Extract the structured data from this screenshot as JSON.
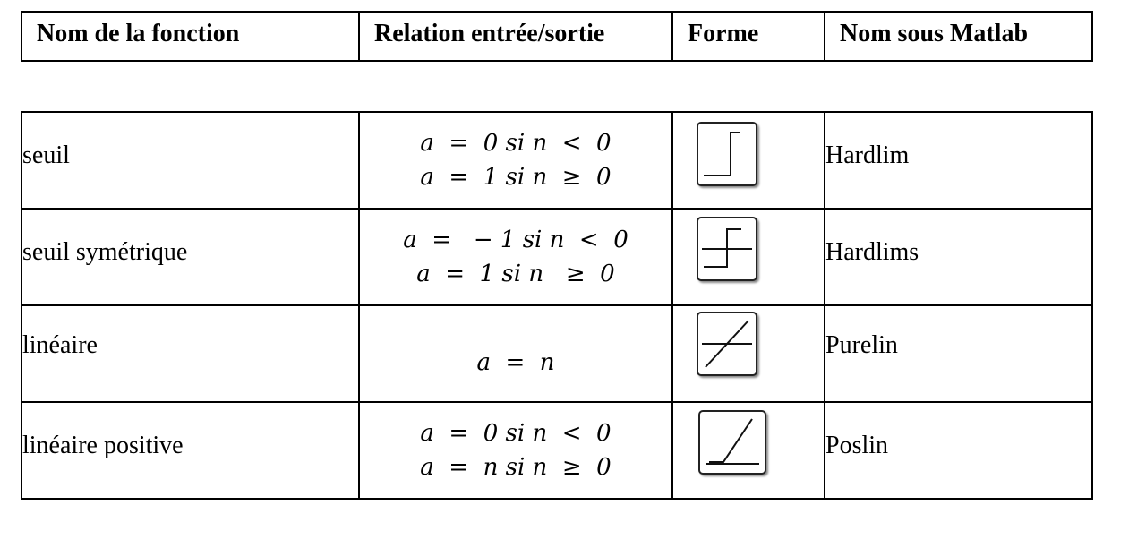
{
  "header": {
    "col1": "Nom de la fonction",
    "col2": "Relation  entrée/sortie",
    "col3": "Forme",
    "col4": "Nom sous Matlab"
  },
  "rows": [
    {
      "name": "seuil",
      "relation": [
        "a  =  0 si n  <  0",
        "a  =  1 si n  ≥  0"
      ],
      "icon": "hardlim-step-icon",
      "matlab": "Hardlim"
    },
    {
      "name": "seuil symétrique",
      "relation": [
        "a  =   − 1 si n  <  0",
        "a  =  1 si n   ≥  0"
      ],
      "icon": "hardlims-symmetric-step-icon",
      "matlab": "Hardlims"
    },
    {
      "name": "linéaire",
      "relation": [
        "a  =  n"
      ],
      "icon": "purelin-linear-icon",
      "matlab": "Purelin"
    },
    {
      "name": "linéaire positive",
      "relation": [
        "a  =  0 si n  <  0",
        "a  =  n si n  ≥  0"
      ],
      "icon": "poslin-positive-linear-icon",
      "matlab": "Poslin"
    }
  ]
}
